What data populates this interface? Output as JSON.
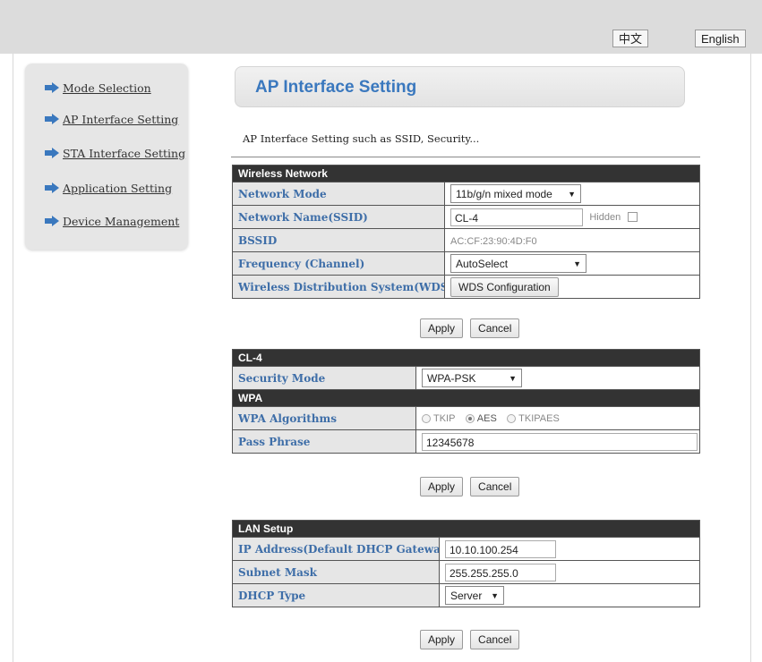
{
  "lang": {
    "chinese": "中文",
    "english": "English"
  },
  "sidebar": {
    "items": [
      {
        "label": "Mode Selection"
      },
      {
        "label": "AP Interface Setting"
      },
      {
        "label": "STA Interface Setting"
      },
      {
        "label": "Application Setting"
      },
      {
        "label": "Device Management"
      }
    ]
  },
  "page": {
    "title": "AP Interface Setting",
    "description": "AP Interface Setting such as SSID, Security..."
  },
  "wireless": {
    "header": "Wireless Network",
    "network_mode": {
      "label": "Network Mode",
      "value": "11b/g/n mixed mode"
    },
    "ssid": {
      "label": "Network Name(SSID)",
      "value": "CL-4",
      "hidden_label": "Hidden"
    },
    "bssid": {
      "label": "BSSID",
      "value": "AC:CF:23:90:4D:F0"
    },
    "frequency": {
      "label": "Frequency (Channel)",
      "value": "AutoSelect"
    },
    "wds": {
      "label": "Wireless Distribution System(WDS)",
      "button": "WDS Configuration"
    }
  },
  "security": {
    "header": "CL-4",
    "mode": {
      "label": "Security Mode",
      "value": "WPA-PSK"
    },
    "wpa_header": "WPA",
    "algorithms": {
      "label": "WPA Algorithms",
      "options": [
        "TKIP",
        "AES",
        "TKIPAES"
      ],
      "selected": "AES"
    },
    "pass_phrase": {
      "label": "Pass Phrase",
      "value": "12345678"
    }
  },
  "lan": {
    "header": "LAN Setup",
    "ip": {
      "label": "IP Address(Default DHCP Gateway)",
      "value": "10.10.100.254"
    },
    "subnet": {
      "label": "Subnet Mask",
      "value": "255.255.255.0"
    },
    "dhcp": {
      "label": "DHCP Type",
      "value": "Server"
    }
  },
  "buttons": {
    "apply": "Apply",
    "cancel": "Cancel"
  },
  "colors": {
    "label_text": "#3e6ea8",
    "title_text": "#3a78be",
    "header_bg": "#333333",
    "arrow": "#3a78be"
  }
}
